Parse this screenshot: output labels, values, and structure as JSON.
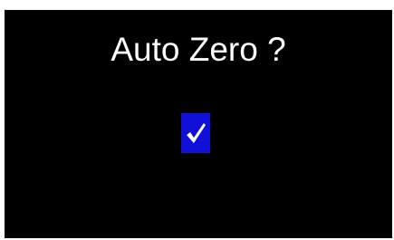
{
  "dialog": {
    "title": "Auto Zero ?",
    "confirm": {
      "icon": "checkmark-icon",
      "glyph": "✓",
      "highlight_color": "#1010d8"
    },
    "background_color": "#000000",
    "text_color": "#ffffff"
  }
}
